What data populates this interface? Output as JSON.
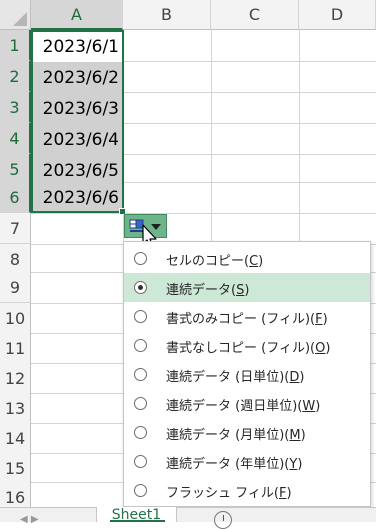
{
  "columns": [
    "A",
    "B",
    "C",
    "D"
  ],
  "rows": [
    "1",
    "2",
    "3",
    "4",
    "5",
    "6",
    "7",
    "8",
    "9",
    "10",
    "11",
    "12",
    "13",
    "14",
    "15",
    "16"
  ],
  "cells_a": [
    "2023/6/1",
    "2023/6/2",
    "2023/6/3",
    "2023/6/4",
    "2023/6/5",
    "2023/6/6"
  ],
  "menu": {
    "selected_index": 1,
    "items": [
      {
        "text": "セルのコピー(",
        "key": "C",
        "tail": ")"
      },
      {
        "text": "連続データ(",
        "key": "S",
        "tail": ")"
      },
      {
        "text": "書式のみコピー (フィル)(",
        "key": "F",
        "tail": ")"
      },
      {
        "text": "書式なしコピー (フィル)(",
        "key": "O",
        "tail": ")"
      },
      {
        "text": "連続データ (日単位)(",
        "key": "D",
        "tail": ")"
      },
      {
        "text": "連続データ (週日単位)(",
        "key": "W",
        "tail": ")"
      },
      {
        "text": "連続データ (月単位)(",
        "key": "M",
        "tail": ")"
      },
      {
        "text": "連続データ (年単位)(",
        "key": "Y",
        "tail": ")"
      },
      {
        "text": "フラッシュ フィル(",
        "key": "F",
        "tail": ")"
      }
    ]
  },
  "sheet_tab": "Sheet1",
  "icons": {
    "autofill": "autofill-options-icon",
    "dropdown": "chevron-down-icon",
    "cursor": "mouse-pointer-icon",
    "add_sheet": "plus-circle-icon"
  },
  "colors": {
    "accent": "#217346",
    "button": "#6db48b",
    "highlight": "#cde8d6"
  }
}
